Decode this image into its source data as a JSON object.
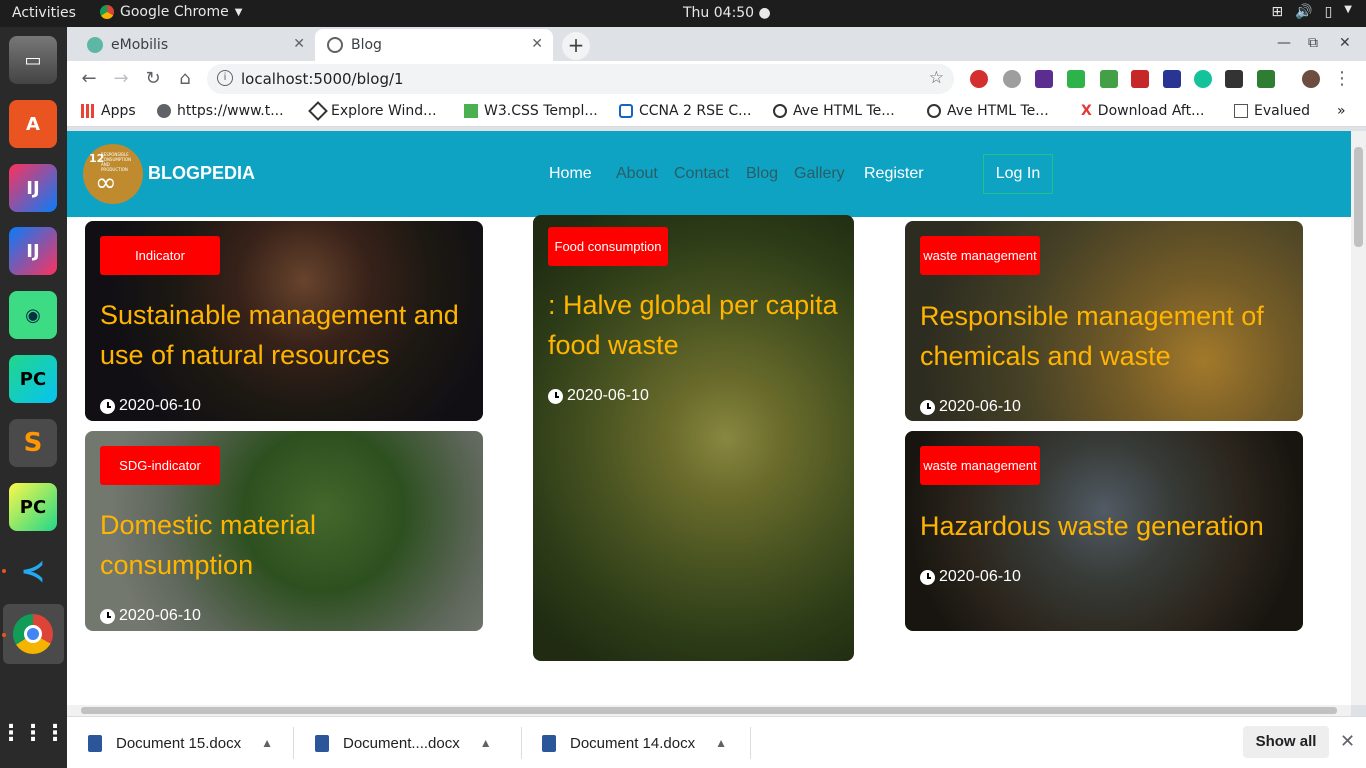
{
  "topbar": {
    "activities": "Activities",
    "app_name": "Google Chrome",
    "clock": "Thu 04:50 ●"
  },
  "dock": {
    "items": [
      "files-icon",
      "software-icon",
      "intellij-icon",
      "intellij-icon-2",
      "android-studio-icon",
      "pycharm-icon",
      "sublime-icon",
      "pycharm-edu-icon",
      "vscode-icon",
      "chrome-icon",
      "app-grid-icon"
    ]
  },
  "browser": {
    "tabs": [
      {
        "title": "eMobilis",
        "active": false
      },
      {
        "title": "Blog",
        "active": true
      }
    ],
    "url": "localhost:5000/blog/1",
    "bookmarks": [
      "Apps",
      "https://www.t...",
      "Explore Wind...",
      "W3.CSS Templ...",
      "CCNA 2 RSE C...",
      "Ave HTML Te...",
      "Ave HTML Te...",
      "Download Aft...",
      "Evalued"
    ]
  },
  "site": {
    "brand": "BLOGPEDIA",
    "logo_number": "12",
    "logo_text": "RESPONSIBLE CONSUMPTION AND PRODUCTION",
    "nav": [
      "Home",
      "About",
      "Contact",
      "Blog",
      "Gallery",
      "Register"
    ],
    "login": "Log In"
  },
  "posts": [
    {
      "category": "Indicator",
      "title": "Sustainable management and use of natural resources",
      "date": "2020-06-10"
    },
    {
      "category": "SDG-indicator",
      "title": "Domestic material consumption",
      "date": "2020-06-10"
    },
    {
      "category": "Food consumption",
      "title": ": Halve global per capita food waste",
      "date": "2020-06-10"
    },
    {
      "category": "waste management",
      "title": "Responsible management of chemicals and waste",
      "date": "2020-06-10"
    },
    {
      "category": "waste management",
      "title": "Hazardous waste generation",
      "date": "2020-06-10"
    }
  ],
  "downloads": {
    "files": [
      "Document 15.docx",
      "Document....docx",
      "Document 14.docx"
    ],
    "show_all": "Show all"
  },
  "colors": {
    "navbar": "#0ea3c3",
    "badge": "#ff0000",
    "title": "#ffb400"
  }
}
